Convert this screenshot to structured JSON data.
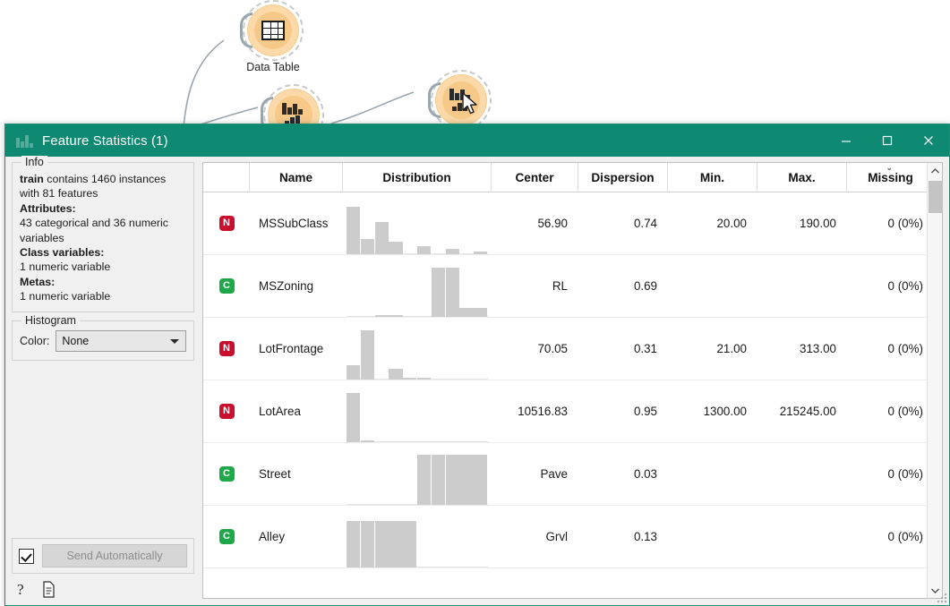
{
  "canvas": {
    "nodes": [
      {
        "name": "node-data-table",
        "label": "Data Table",
        "icon": "table-icon"
      },
      {
        "name": "node-feature-statistics-left",
        "label": "",
        "icon": "bar-chart-icon"
      },
      {
        "name": "node-feature-statistics-right",
        "label": "",
        "icon": "bar-chart-icon"
      }
    ]
  },
  "window": {
    "title": "Feature Statistics (1)",
    "app_icon": "feature-statistics-icon",
    "minimize_label": "—",
    "maximize_label": "□",
    "close_label": "✕",
    "accent_color": "#0f8a72"
  },
  "info": {
    "group_title": "Info",
    "line1_bold": "train",
    "line1_rest": " contains 1460 instances with 81 features",
    "attributes_label": "Attributes:",
    "attributes_value": "43 categorical and 36 numeric variables",
    "class_label": "Class variables:",
    "class_value": "1 numeric variable",
    "metas_label": "Metas:",
    "metas_value": "1 numeric variable"
  },
  "histogram": {
    "group_title": "Histogram",
    "color_label": "Color:",
    "color_value": "None",
    "color_options": [
      "None"
    ]
  },
  "footer": {
    "send_checkbox_checked": true,
    "send_button_label": "Send Automatically",
    "help_icon": "question-mark-icon",
    "report_icon": "document-icon"
  },
  "table": {
    "columns": [
      {
        "key": "badge",
        "label": "",
        "width": 52,
        "align": "center",
        "sorted": false
      },
      {
        "key": "name",
        "label": "Name",
        "width": 104,
        "align": "left",
        "sorted": false
      },
      {
        "key": "dist",
        "label": "Distribution",
        "width": 166,
        "align": "center",
        "sorted": false
      },
      {
        "key": "center",
        "label": "Center",
        "width": 97,
        "align": "right",
        "sorted": false
      },
      {
        "key": "dispersion",
        "label": "Dispersion",
        "width": 100,
        "align": "right",
        "sorted": false
      },
      {
        "key": "min",
        "label": "Min.",
        "width": 100,
        "align": "right",
        "sorted": false
      },
      {
        "key": "max",
        "label": "Max.",
        "width": 100,
        "align": "right",
        "sorted": false
      },
      {
        "key": "missing",
        "label": "Missing",
        "width": 97,
        "align": "right",
        "sorted": true
      }
    ],
    "sort_indicator": "⌄",
    "rows": [
      {
        "badge": "N",
        "badge_type": "numeric",
        "name": "MSSubClass",
        "center": "56.90",
        "dispersion": "0.74",
        "min": "20.00",
        "max": "190.00",
        "missing": "0 (0%)",
        "distribution": [
          0.92,
          0.3,
          0.62,
          0.24,
          0.0,
          0.15,
          0.0,
          0.1,
          0.0,
          0.05
        ]
      },
      {
        "badge": "C",
        "badge_type": "categorical",
        "name": "MSZoning",
        "center": "RL",
        "dispersion": "0.69",
        "min": "",
        "max": "",
        "missing": "0 (0%)",
        "distribution": [
          0.0,
          0.0,
          0.02,
          0.02,
          0.0,
          0.0,
          0.94,
          0.94,
          0.17,
          0.17
        ]
      },
      {
        "badge": "N",
        "badge_type": "numeric",
        "name": "LotFrontage",
        "center": "70.05",
        "dispersion": "0.31",
        "min": "21.00",
        "max": "313.00",
        "missing": "0 (0%)",
        "distribution": [
          0.28,
          0.94,
          0.0,
          0.2,
          0.03,
          0.01,
          0.0,
          0.0,
          0.0,
          0.0
        ]
      },
      {
        "badge": "N",
        "badge_type": "numeric",
        "name": "LotArea",
        "center": "10516.83",
        "dispersion": "0.95",
        "min": "1300.00",
        "max": "215245.00",
        "missing": "0 (0%)",
        "distribution": [
          0.95,
          0.02,
          0.0,
          0.0,
          0.0,
          0.0,
          0.0,
          0.0,
          0.0,
          0.0
        ]
      },
      {
        "badge": "C",
        "badge_type": "categorical",
        "name": "Street",
        "center": "Pave",
        "dispersion": "0.03",
        "min": "",
        "max": "",
        "missing": "0 (0%)",
        "distribution": [
          0.0,
          0.0,
          0.0,
          0.0,
          0.0,
          0.96,
          0.96,
          0.96,
          0.96,
          0.96
        ]
      },
      {
        "badge": "C",
        "badge_type": "categorical",
        "name": "Alley",
        "center": "Grvl",
        "dispersion": "0.13",
        "min": "",
        "max": "",
        "missing": "0 (0%)",
        "distribution": [
          0.9,
          0.9,
          0.9,
          0.9,
          0.9,
          0.0,
          0.0,
          0.0,
          0.0,
          0.0
        ]
      }
    ],
    "scrollbar": {
      "up_arrow": "∧",
      "down_arrow": "∨",
      "thumb_position": "top"
    }
  }
}
